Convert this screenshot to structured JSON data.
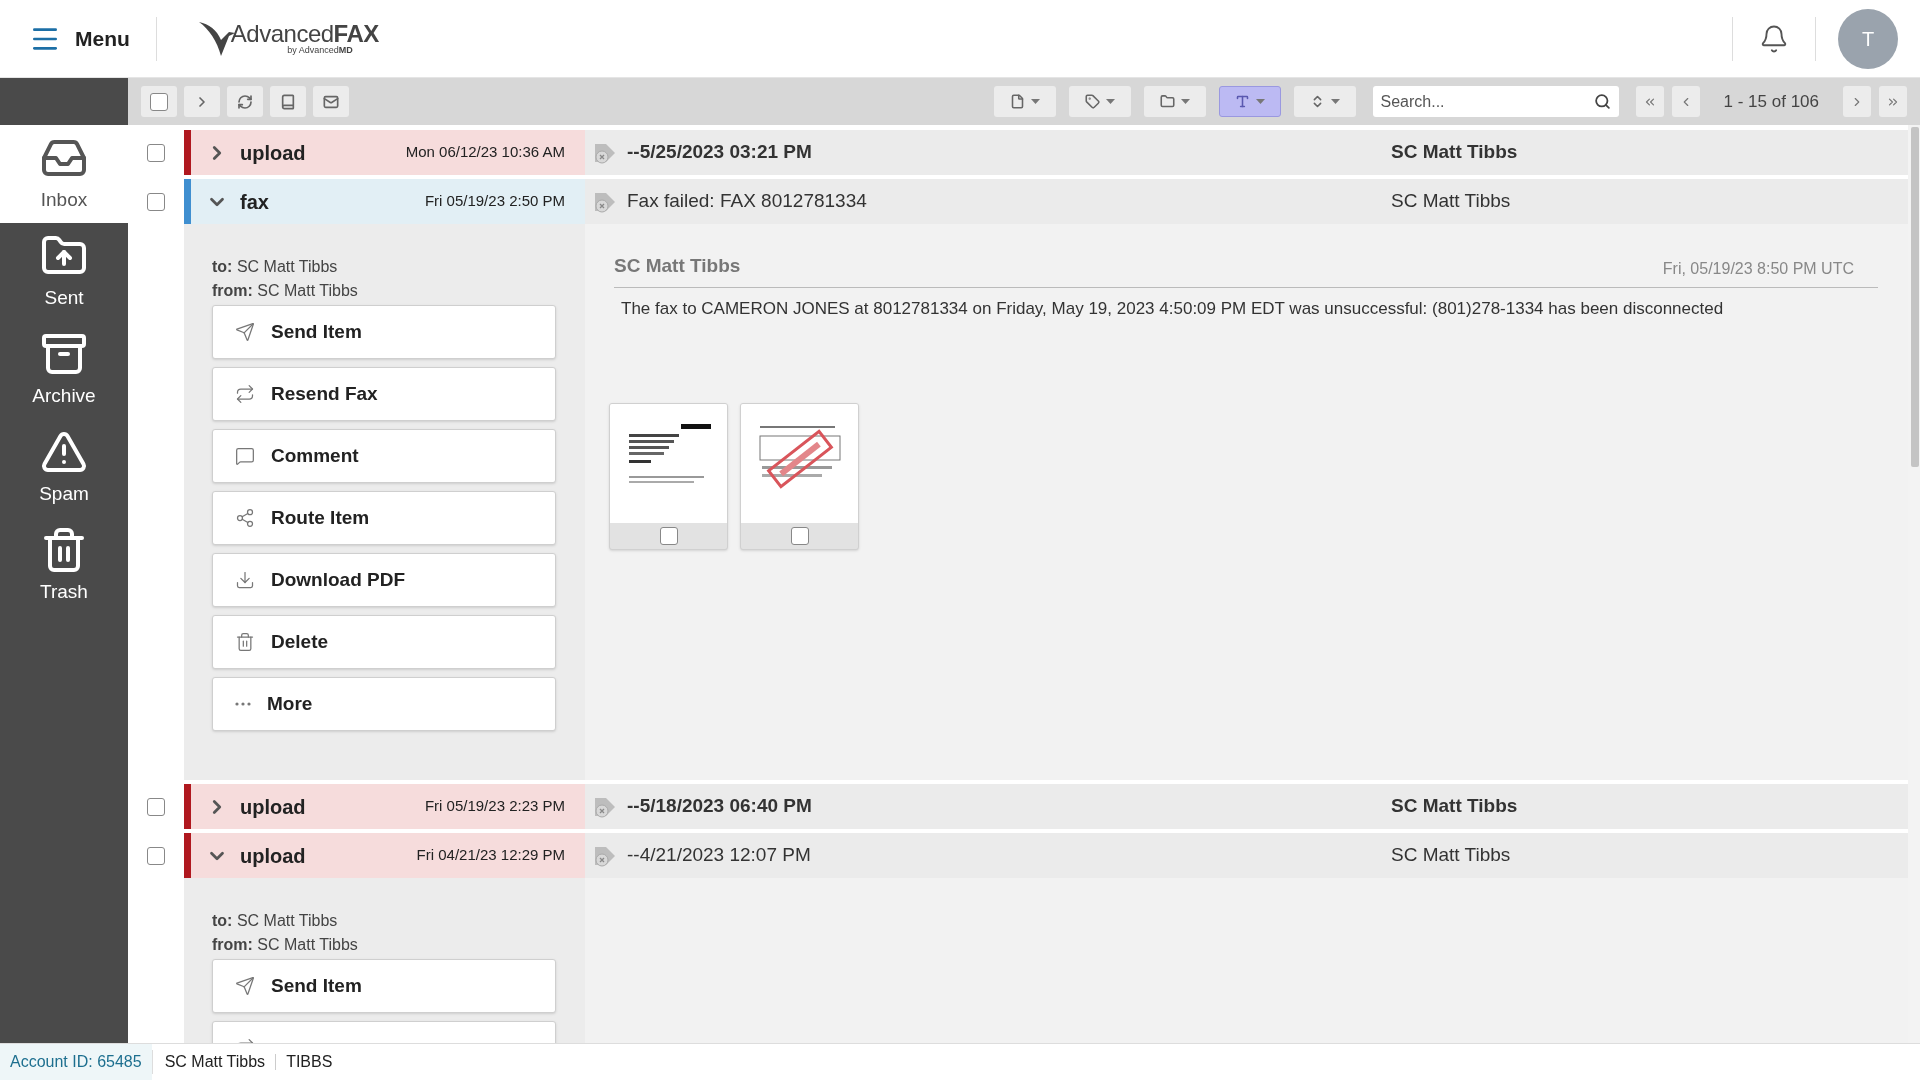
{
  "header": {
    "menu_label": "Menu",
    "logo": {
      "name": "Advanced**FAX**",
      "tagline": "by Advanced**MD**"
    },
    "avatar_initial": "T"
  },
  "toolbar": {
    "actions": [
      {
        "kind": "checkbox",
        "checked": false
      },
      {
        "kind": "forward"
      },
      {
        "kind": "refresh"
      },
      {
        "kind": "book"
      },
      {
        "kind": "mail"
      }
    ],
    "filters": [
      {
        "kind": "file",
        "selected": false
      },
      {
        "kind": "tag",
        "selected": false
      },
      {
        "kind": "folder",
        "selected": false
      },
      {
        "kind": "font",
        "selected": true
      },
      {
        "kind": "sort",
        "selected": false
      }
    ],
    "search": {
      "placeholder": "Search..."
    },
    "page_range": "1 - 15 of 106"
  },
  "sidebar": {
    "items": [
      {
        "kind": "inbox",
        "label": "Inbox",
        "selected": true
      },
      {
        "kind": "sent",
        "label": "Sent",
        "selected": false
      },
      {
        "kind": "archive",
        "label": "Archive",
        "selected": false
      },
      {
        "kind": "spam",
        "label": "Spam",
        "selected": false
      },
      {
        "kind": "trash",
        "label": "Trash",
        "selected": false
      }
    ]
  },
  "messages": [
    {
      "kind": "upload",
      "name": "upload",
      "date": "Mon 06/12/23 10:36 AM",
      "subject": "--5/25/2023 03:21 PM",
      "sender": "SC Matt Tibbs",
      "unread": true,
      "expanded": false,
      "checked": false
    },
    {
      "kind": "fax",
      "name": "fax",
      "date": "Fri 05/19/23 2:50 PM",
      "subject": "Fax failed: FAX 8012781334",
      "sender": "SC Matt Tibbs",
      "unread": false,
      "expanded": true,
      "checked": false,
      "detail": {
        "to": "**to:** SC Matt Tibbs",
        "from": "**from:** SC Matt Tibbs",
        "actions": [
          {
            "kind": "send",
            "label": "Send Item"
          },
          {
            "kind": "resend",
            "label": "Resend Fax"
          },
          {
            "kind": "comment",
            "label": "Comment"
          },
          {
            "kind": "route",
            "label": "Route Item"
          },
          {
            "kind": "download",
            "label": "Download PDF"
          },
          {
            "kind": "delete",
            "label": "Delete"
          },
          {
            "kind": "more",
            "label": "More"
          }
        ],
        "message": {
          "sender": "SC Matt Tibbs",
          "timestamp": "Fri, 05/19/23 8:50 PM UTC",
          "body": "The fax to CAMERON JONES at 8012781334 on Friday, May 19, 2023 4:50:09 PM EDT was unsuccessful: (801)278-1334 has been disconnected"
        },
        "attachments": [
          {
            "kind": "cover",
            "checked": false
          },
          {
            "kind": "stamped",
            "checked": false
          }
        ]
      }
    },
    {
      "kind": "upload",
      "name": "upload",
      "date": "Fri 05/19/23 2:23 PM",
      "subject": "--5/18/2023 06:40 PM",
      "sender": "SC Matt Tibbs",
      "unread": true,
      "expanded": false,
      "checked": false
    },
    {
      "kind": "upload",
      "name": "upload",
      "date": "Fri 04/21/23 12:29 PM",
      "subject": "--4/21/2023 12:07 PM",
      "sender": "SC Matt Tibbs",
      "unread": false,
      "expanded": true,
      "checked": false,
      "detail": {
        "to": "**to:** SC Matt Tibbs",
        "from": "**from:** SC Matt Tibbs",
        "actions": [
          {
            "kind": "send",
            "label": "Send Item"
          },
          {
            "kind": "resend"
          }
        ]
      }
    }
  ],
  "status_bar": {
    "account": "Account ID: 65485",
    "user": "SC Matt Tibbs",
    "login": "TIBBS"
  }
}
